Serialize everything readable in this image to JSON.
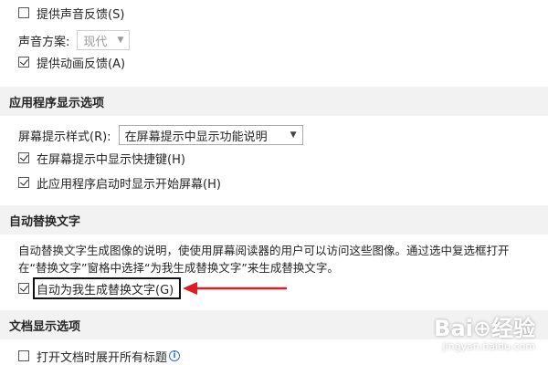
{
  "options": {
    "sound_feedback": {
      "label": "提供声音反馈(S)",
      "checked": false
    },
    "sound_scheme": {
      "label": "声音方案:",
      "value": "现代",
      "enabled": false
    },
    "animation_feedback": {
      "label": "提供动画反馈(A)",
      "checked": true
    }
  },
  "app_display": {
    "heading": "应用程序显示选项",
    "screentip_style": {
      "label": "屏幕提示样式(R):",
      "value": "在屏幕提示中显示功能说明"
    },
    "show_shortcuts": {
      "label": "在屏幕提示中显示快捷键(H)",
      "checked": true
    },
    "show_start_screen": {
      "label": "此应用程序启动时显示开始屏幕(H)",
      "checked": true
    }
  },
  "alt_text": {
    "heading": "自动替换文字",
    "description_line1": "自动替换文字生成图像的说明，使使用屏幕阅读器的用户可以访问这些图像。通过选中复选框打开",
    "description_line2": "在“替换文字”窗格中选择“为我生成替换文字”来生成替换文字。",
    "auto_generate": {
      "label": "自动为我生成替换文字(G)",
      "checked": true
    }
  },
  "doc_display": {
    "heading": "文档显示选项",
    "expand_headings": {
      "label": "打开文档时展开所有标题",
      "checked": false
    }
  },
  "watermark": {
    "logo": "Bai⊕经验",
    "url": "jingyan.baidu.com"
  },
  "colors": {
    "section_bg": "#f2f2f2",
    "arrow": "#e01b24",
    "info_icon": "#2b6fd6"
  }
}
